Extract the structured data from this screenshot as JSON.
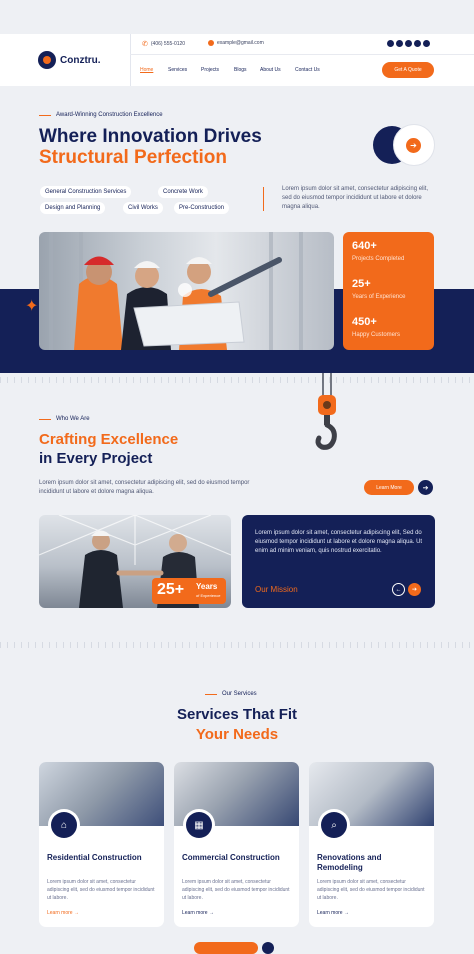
{
  "brand": {
    "name": "Conztru.",
    "accent": "#f26a1b",
    "navy": "#142057"
  },
  "contact": {
    "phone": "(406) 555-0120",
    "email": "example@gmail.com",
    "phone_icon": "phone-icon",
    "email_icon": "mail-icon"
  },
  "socials": [
    "facebook-icon",
    "x-icon",
    "instagram-icon",
    "pinterest-icon",
    "linkedin-icon"
  ],
  "nav": {
    "items": [
      "Home",
      "Services",
      "Projects",
      "Blogs",
      "About Us",
      "Contact Us"
    ],
    "active": "Home",
    "cta": "Get A Quote"
  },
  "hero": {
    "eyebrow": "Award-Winning Construction Excellence",
    "title_line1": "Where Innovation Drives",
    "title_line2": "Structural Perfection",
    "chips": [
      "General Construction Services",
      "Concrete  Work",
      "Design and Planning",
      "Civil Works",
      "Pre-Construction"
    ],
    "paragraph": "Lorem ipsum dolor sit amet, consectetur adipiscing elit, sed do eiusmod tempor incididunt ut labore et dolore magna aliqua.",
    "stats": [
      {
        "value": "640+",
        "label": "Projects Completed"
      },
      {
        "value": "25+",
        "label": "Years of Experience"
      },
      {
        "value": "450+",
        "label": "Happy Customers"
      }
    ]
  },
  "about": {
    "eyebrow": "Who We Are",
    "title_line1": "Crafting Excellence",
    "title_line2": "in Every Project",
    "paragraph": "Lorem ipsum dolor sit amet, consectetur adipiscing elit, sed do eiusmod tempor incididunt ut labore et dolore magna aliqua.",
    "cta": "Learn More",
    "years_value": "25+",
    "years_label": "Years",
    "years_sub": "of Experience",
    "mission_text": "Lorem ipsum dolor sit amet, consectetur adipiscing elit, Sed do eiusmod tempor incididunt ut labore et dolore magna aliqua. Ut enim ad minim veniam, quis nostrud exercitatio.",
    "mission_label": "Our Mission"
  },
  "services": {
    "eyebrow": "Our Services",
    "title_line1": "Services That Fit",
    "title_line2": "Your Needs",
    "cards": [
      {
        "title": "Residential Construction",
        "text": "Lorem ipsum dolor sit amet, consectetur adipiscing elit, sed do eiusmod tempor incididunt ut labore.",
        "link": "Learn more",
        "icon": "house-icon"
      },
      {
        "title": "Commercial Construction",
        "text": "Lorem ipsum dolor sit amet, consectetur adipiscing elit, sed do eiusmod tempor incididunt ut labore.",
        "link": "Learn more",
        "icon": "building-icon"
      },
      {
        "title": "Renovations and Remodeling",
        "text": "Lorem ipsum dolor sit amet, consectetur adipiscing elit, sed do eiusmod tempor incididunt ut labore.",
        "link": "Learn more",
        "icon": "search-house-icon"
      }
    ]
  }
}
